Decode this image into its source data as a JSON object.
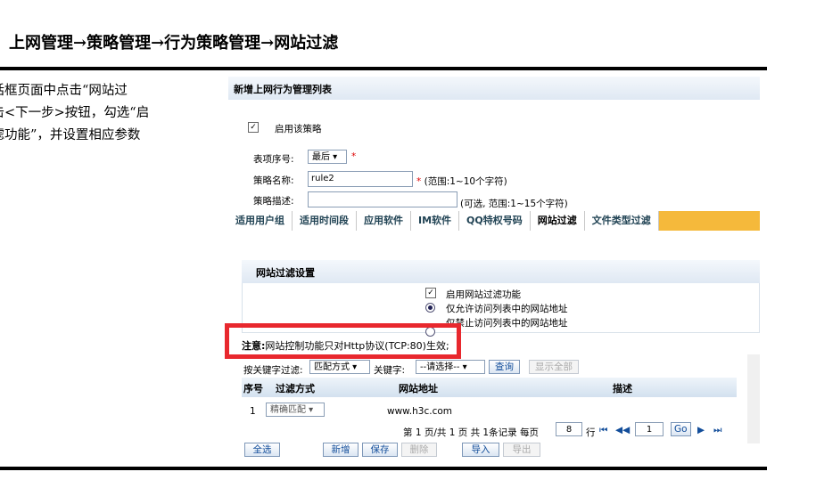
{
  "slide": {
    "title": "上网管理→策略管理→行为策略管理→网站过滤",
    "instructions": [
      "对话框页面中点击“网站过",
      "点击<下一步>按钮，勾选“启",
      "过滤功能”，并设置相应参数"
    ]
  },
  "dialog": {
    "header": "新增上网行为管理列表",
    "enable_label": "启用该策略",
    "enable_checked": "✓",
    "index_label": "表项序号:",
    "index_value": "最后 ▾",
    "required_mark": "*",
    "name_label": "策略名称:",
    "name_value": "rule2",
    "name_hint": "(范围:1~10个字符)",
    "desc_label": "策略描述:",
    "desc_value": "",
    "desc_hint": "(可选, 范围:1~15个字符)",
    "tabs": [
      "适用用户组",
      "适用时间段",
      "应用软件",
      "IM软件",
      "QQ特权号码",
      "网站过滤",
      "文件类型过滤"
    ],
    "active_tab": "网站过滤"
  },
  "filter": {
    "section_title": "网站过滤设置",
    "enable_label": "启用网站过滤功能",
    "enable_checked": "✓",
    "allow_label": "仅允许访问列表中的网站地址",
    "deny_label": "仅禁止访问列表中的网站地址",
    "note_prefix": "注意:",
    "note_text": "网站控制功能只对Http协议(TCP:80)生效;",
    "keyword_filter_label": "按关键字过滤:",
    "match_select": "匹配方式 ▾",
    "keyword_label": "关键字:",
    "keyword_select": "--请选择-- ▾",
    "query_button": "查询",
    "show_all_button": "显示全部",
    "columns": [
      "序号",
      "过滤方式",
      "网站地址",
      "描述"
    ],
    "rows": [
      {
        "index": "1",
        "mode": "精确匹配 ▾",
        "url": "www.h3c.com",
        "desc": ""
      }
    ],
    "pager_text": "第 1 页/共 1 页 共 1条记录 每页",
    "per_page": "8",
    "row_unit": "行",
    "first": "⏮",
    "prev": "◀◀",
    "page_input": "1",
    "go": "Go",
    "next": "▶",
    "last": "⏭",
    "select_all": "全选",
    "new": "新增",
    "save": "保存",
    "delete": "删除",
    "import": "导入",
    "export": "导出"
  },
  "colors": {
    "highlight": "#e8282e",
    "tab_bar": "#f5b93b",
    "header_bg": "#dfe8f3"
  }
}
